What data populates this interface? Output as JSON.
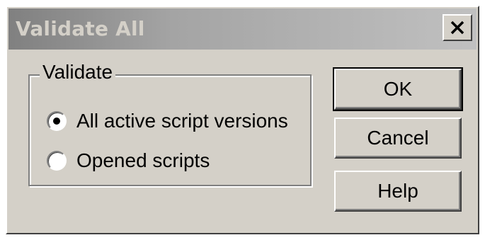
{
  "window": {
    "title": "Validate All",
    "close_icon": "close-icon"
  },
  "group": {
    "legend": "Validate",
    "options": [
      {
        "label": "All active script versions",
        "selected": true
      },
      {
        "label": "Opened scripts",
        "selected": false
      }
    ]
  },
  "buttons": {
    "ok": "OK",
    "cancel": "Cancel",
    "help": "Help"
  },
  "colors": {
    "dialog_face": "#d4d0c8",
    "titlebar_inactive": "#808080",
    "title_text": "#d4d0c8"
  }
}
